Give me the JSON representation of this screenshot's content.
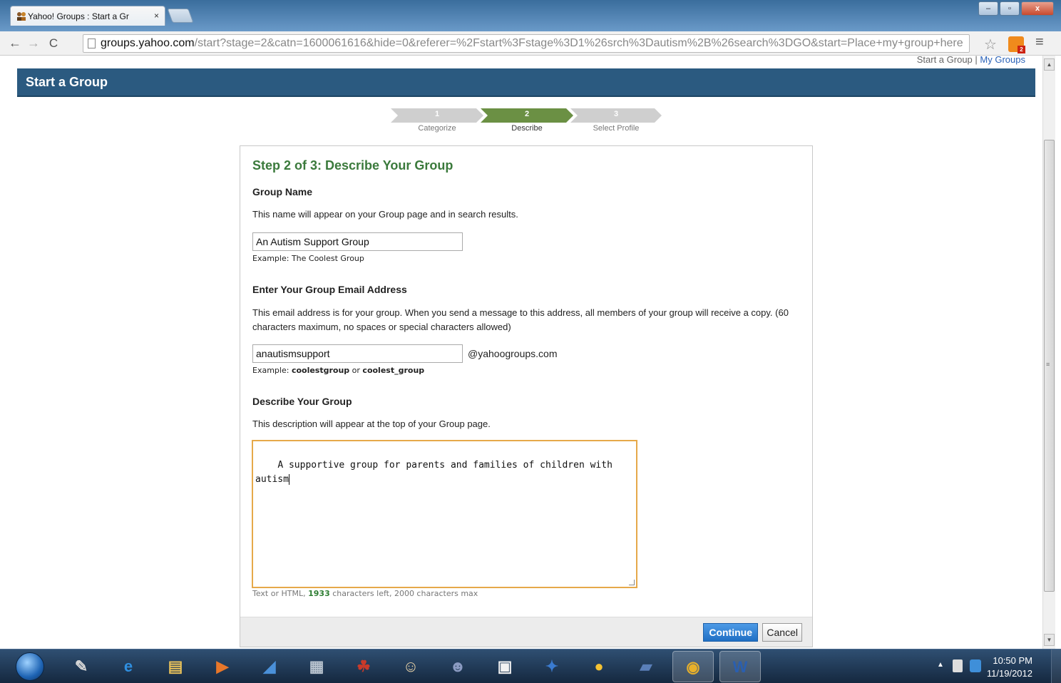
{
  "browser": {
    "tab_title": "Yahoo! Groups : Start a Gr",
    "tab_close": "×",
    "url_host": "groups.yahoo.com",
    "url_path": "/start?stage=2&catn=1600061616&hide=0&referer=%2Fstart%3Fstage%3D1%26srch%3Dautism%2B%26search%3DGO&start=Place+my+group+here",
    "rss_badge": "2",
    "window_buttons": {
      "minimize": "–",
      "maximize": "▫",
      "close": "x"
    }
  },
  "nav": {
    "back": "←",
    "forward": "→",
    "reload": "C",
    "star": "☆",
    "menu": "≡"
  },
  "top_links": {
    "start_group": "Start a Group",
    "separator": "|",
    "my_groups": "My Groups"
  },
  "header": {
    "title": "Start a Group"
  },
  "steps": [
    {
      "num": "1",
      "label": "Categorize",
      "active": false
    },
    {
      "num": "2",
      "label": "Describe",
      "active": true
    },
    {
      "num": "3",
      "label": "Select Profile",
      "active": false
    }
  ],
  "form": {
    "heading": "Step 2 of 3: Describe Your Group",
    "group_name": {
      "label": "Group Name",
      "help": "This name will appear on your Group page and in search results.",
      "value": "An Autism Support Group",
      "example_prefix": "Example: ",
      "example": "The Coolest Group"
    },
    "email": {
      "label": "Enter Your Group Email Address",
      "help": "This email address is for your group. When you send a message to this address, all members of your group will receive a copy. (60 characters maximum, no spaces or special characters allowed)",
      "value": "anautismsupport",
      "suffix": "@yahoogroups.com",
      "example_prefix": "Example: ",
      "example_1": "coolestgroup",
      "example_or": " or ",
      "example_2": "coolest_group"
    },
    "description": {
      "label": "Describe Your Group",
      "help": "This description will appear at the top of your Group page.",
      "value": "A supportive group for parents and families of children with\nautism",
      "counter_prefix": "Text or HTML, ",
      "chars_left": "1933",
      "counter_suffix": " characters left, 2000 characters max"
    },
    "continue_label": "Continue",
    "cancel_label": "Cancel"
  },
  "taskbar": {
    "time": "10:50 PM",
    "date": "11/19/2012",
    "tray_arrow": "▲",
    "apps": [
      {
        "name": "notepad-icon",
        "glyph": "✎",
        "color": "#d8d8d8"
      },
      {
        "name": "internet-explorer-icon",
        "glyph": "e",
        "color": "#2f8fe0"
      },
      {
        "name": "file-explorer-icon",
        "glyph": "▤",
        "color": "#e8c15a"
      },
      {
        "name": "media-player-icon",
        "glyph": "▶",
        "color": "#e8772a"
      },
      {
        "name": "app-blue-icon",
        "glyph": "◢",
        "color": "#4a90d9"
      },
      {
        "name": "calculator-icon",
        "glyph": "▦",
        "color": "#b9c4cf"
      },
      {
        "name": "game-dragon-icon",
        "glyph": "☘",
        "color": "#c83a2a"
      },
      {
        "name": "game-cow-icon",
        "glyph": "☺",
        "color": "#e9d3a8"
      },
      {
        "name": "game-character-icon",
        "glyph": "☻",
        "color": "#8b9bc2"
      },
      {
        "name": "document-icon",
        "glyph": "▣",
        "color": "#f2f2f2"
      },
      {
        "name": "game-blue-icon",
        "glyph": "✦",
        "color": "#3a7bd0"
      },
      {
        "name": "game-penguin-icon",
        "glyph": "●",
        "color": "#f4c233"
      },
      {
        "name": "movie-maker-icon",
        "glyph": "▰",
        "color": "#5a7fb8"
      },
      {
        "name": "chrome-icon",
        "glyph": "◉",
        "color": "#e8b02a"
      },
      {
        "name": "word-icon",
        "glyph": "W",
        "color": "#2a5fb0"
      }
    ]
  }
}
